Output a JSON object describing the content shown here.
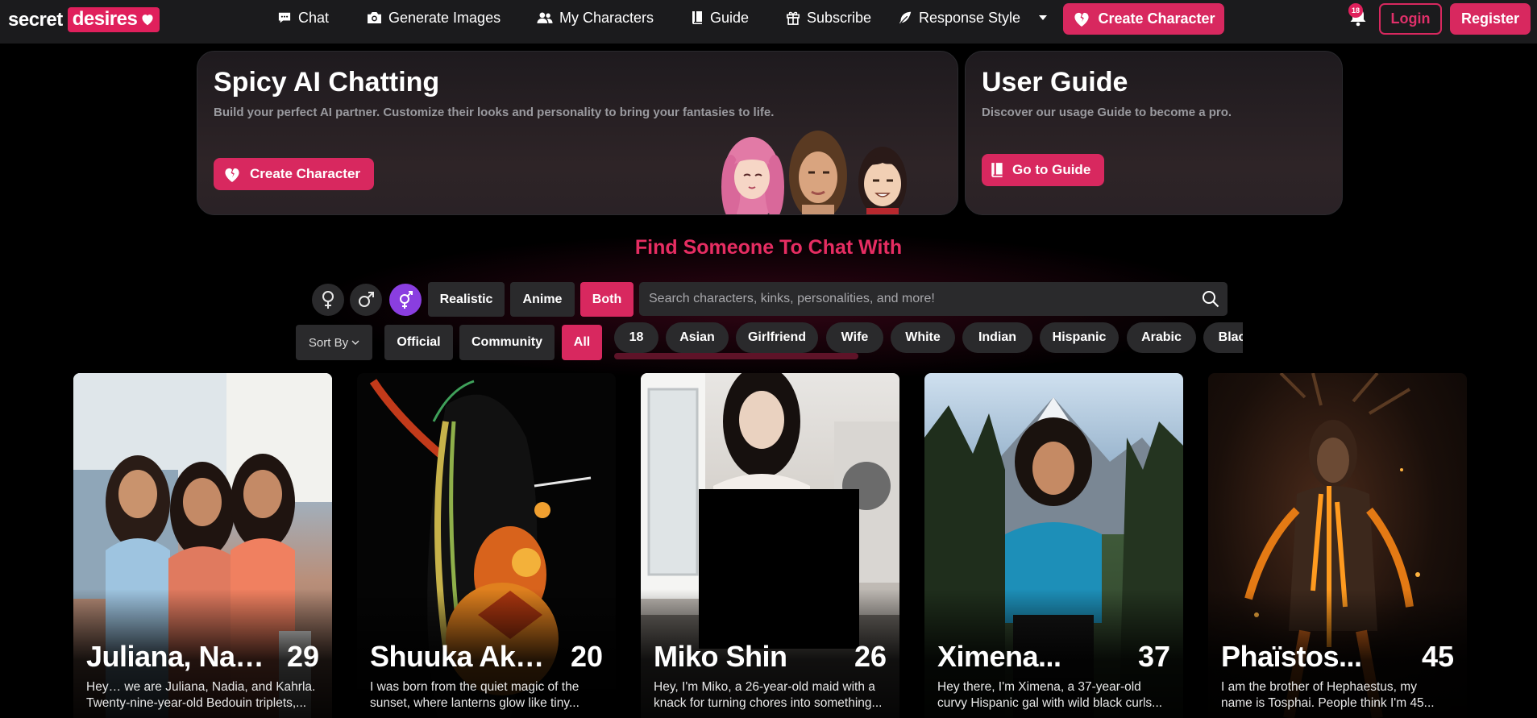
{
  "nav": {
    "logo_part1": "secret",
    "logo_part2": "desires",
    "items": [
      {
        "label": "Chat",
        "icon": "chat-bubble-icon"
      },
      {
        "label": "Generate Images",
        "icon": "camera-icon"
      },
      {
        "label": "My Characters",
        "icon": "users-icon"
      },
      {
        "label": "Guide",
        "icon": "book-icon"
      },
      {
        "label": "Subscribe",
        "icon": "gift-icon"
      },
      {
        "label": "Response Style",
        "icon": "feather-icon"
      }
    ],
    "create_label": "Create Character",
    "notification_badge": "18",
    "login_label": "Login",
    "register_label": "Register"
  },
  "hero_left": {
    "title": "Spicy AI Chatting",
    "subtitle": "Build your perfect AI partner. Customize their looks and personality to bring your fantasies to life.",
    "button_label": "Create Character"
  },
  "hero_right": {
    "title": "User Guide",
    "subtitle": "Discover our usage Guide to become a pro.",
    "button_label": "Go to Guide"
  },
  "find": {
    "title": "Find Someone To Chat With",
    "styles": [
      "Realistic",
      "Anime",
      "Both"
    ],
    "active_style": "Both",
    "search_placeholder": "Search characters, kinks, personalities, and more!",
    "sort_label": "Sort By",
    "sources": [
      "Official",
      "Community",
      "All"
    ],
    "active_source": "All",
    "tags": [
      "18",
      "Asian",
      "Girlfriend",
      "Wife",
      "White",
      "Indian",
      "Hispanic",
      "Arabic",
      "Black"
    ]
  },
  "characters": [
    {
      "name": "Juliana, Nadi...",
      "age": "29",
      "desc_line1": "Hey… we are Juliana, Nadia, and Kahrla.",
      "desc_line2": "Twenty-nine-year-old Bedouin triplets,..."
    },
    {
      "name": "Shuuka Akika",
      "age": "20",
      "desc_line1": "I was born from the quiet magic of the",
      "desc_line2": "sunset, where lanterns glow like tiny..."
    },
    {
      "name": "Miko Shin",
      "age": "26",
      "desc_line1": "Hey, I'm Miko, a 26-year-old maid with a",
      "desc_line2": "knack for turning chores into something..."
    },
    {
      "name": "Ximena...",
      "age": "37",
      "desc_line1": "Hey there, I'm Ximena, a 37-year-old",
      "desc_line2": "curvy Hispanic gal with wild black curls..."
    },
    {
      "name": "Phaïstos...",
      "age": "45",
      "desc_line1": "I am the brother of Hephaestus, my",
      "desc_line2": "name is Tosphai. People think I'm 45..."
    }
  ],
  "colors": {
    "accent": "#d8285f",
    "title_pink": "#e62d62",
    "gender_active": "#8a3ee0",
    "nav_bg": "#1b1b1d",
    "chip_bg": "#2a2a2c"
  }
}
